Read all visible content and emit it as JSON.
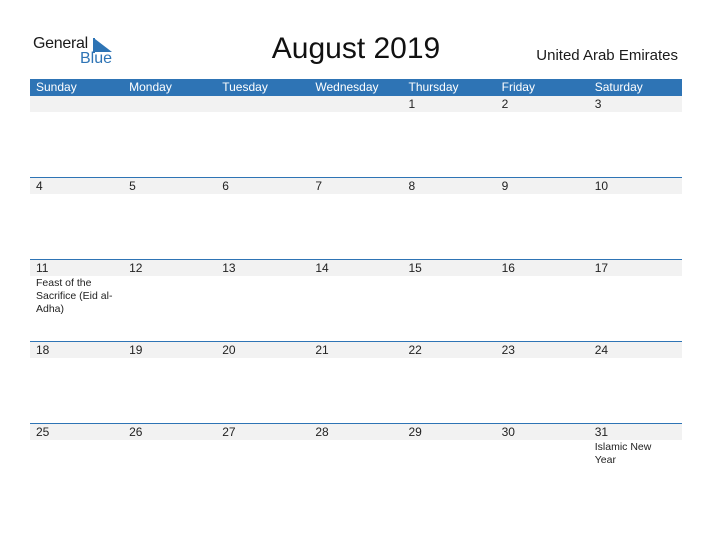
{
  "logo": {
    "line1": "General",
    "line2": "Blue"
  },
  "title": "August 2019",
  "country": "United Arab Emirates",
  "colors": {
    "accent": "#2e74b5",
    "band": "#f2f2f2"
  },
  "weekdays": [
    "Sunday",
    "Monday",
    "Tuesday",
    "Wednesday",
    "Thursday",
    "Friday",
    "Saturday"
  ],
  "weeks": [
    {
      "days": [
        {
          "n": "",
          "e": ""
        },
        {
          "n": "",
          "e": ""
        },
        {
          "n": "",
          "e": ""
        },
        {
          "n": "",
          "e": ""
        },
        {
          "n": "1",
          "e": ""
        },
        {
          "n": "2",
          "e": ""
        },
        {
          "n": "3",
          "e": ""
        }
      ]
    },
    {
      "days": [
        {
          "n": "4",
          "e": ""
        },
        {
          "n": "5",
          "e": ""
        },
        {
          "n": "6",
          "e": ""
        },
        {
          "n": "7",
          "e": ""
        },
        {
          "n": "8",
          "e": ""
        },
        {
          "n": "9",
          "e": ""
        },
        {
          "n": "10",
          "e": ""
        }
      ]
    },
    {
      "days": [
        {
          "n": "11",
          "e": "Feast of the Sacrifice (Eid al-Adha)"
        },
        {
          "n": "12",
          "e": ""
        },
        {
          "n": "13",
          "e": ""
        },
        {
          "n": "14",
          "e": ""
        },
        {
          "n": "15",
          "e": ""
        },
        {
          "n": "16",
          "e": ""
        },
        {
          "n": "17",
          "e": ""
        }
      ]
    },
    {
      "days": [
        {
          "n": "18",
          "e": ""
        },
        {
          "n": "19",
          "e": ""
        },
        {
          "n": "20",
          "e": ""
        },
        {
          "n": "21",
          "e": ""
        },
        {
          "n": "22",
          "e": ""
        },
        {
          "n": "23",
          "e": ""
        },
        {
          "n": "24",
          "e": ""
        }
      ]
    },
    {
      "days": [
        {
          "n": "25",
          "e": ""
        },
        {
          "n": "26",
          "e": ""
        },
        {
          "n": "27",
          "e": ""
        },
        {
          "n": "28",
          "e": ""
        },
        {
          "n": "29",
          "e": ""
        },
        {
          "n": "30",
          "e": ""
        },
        {
          "n": "31",
          "e": "Islamic New Year"
        }
      ]
    }
  ]
}
